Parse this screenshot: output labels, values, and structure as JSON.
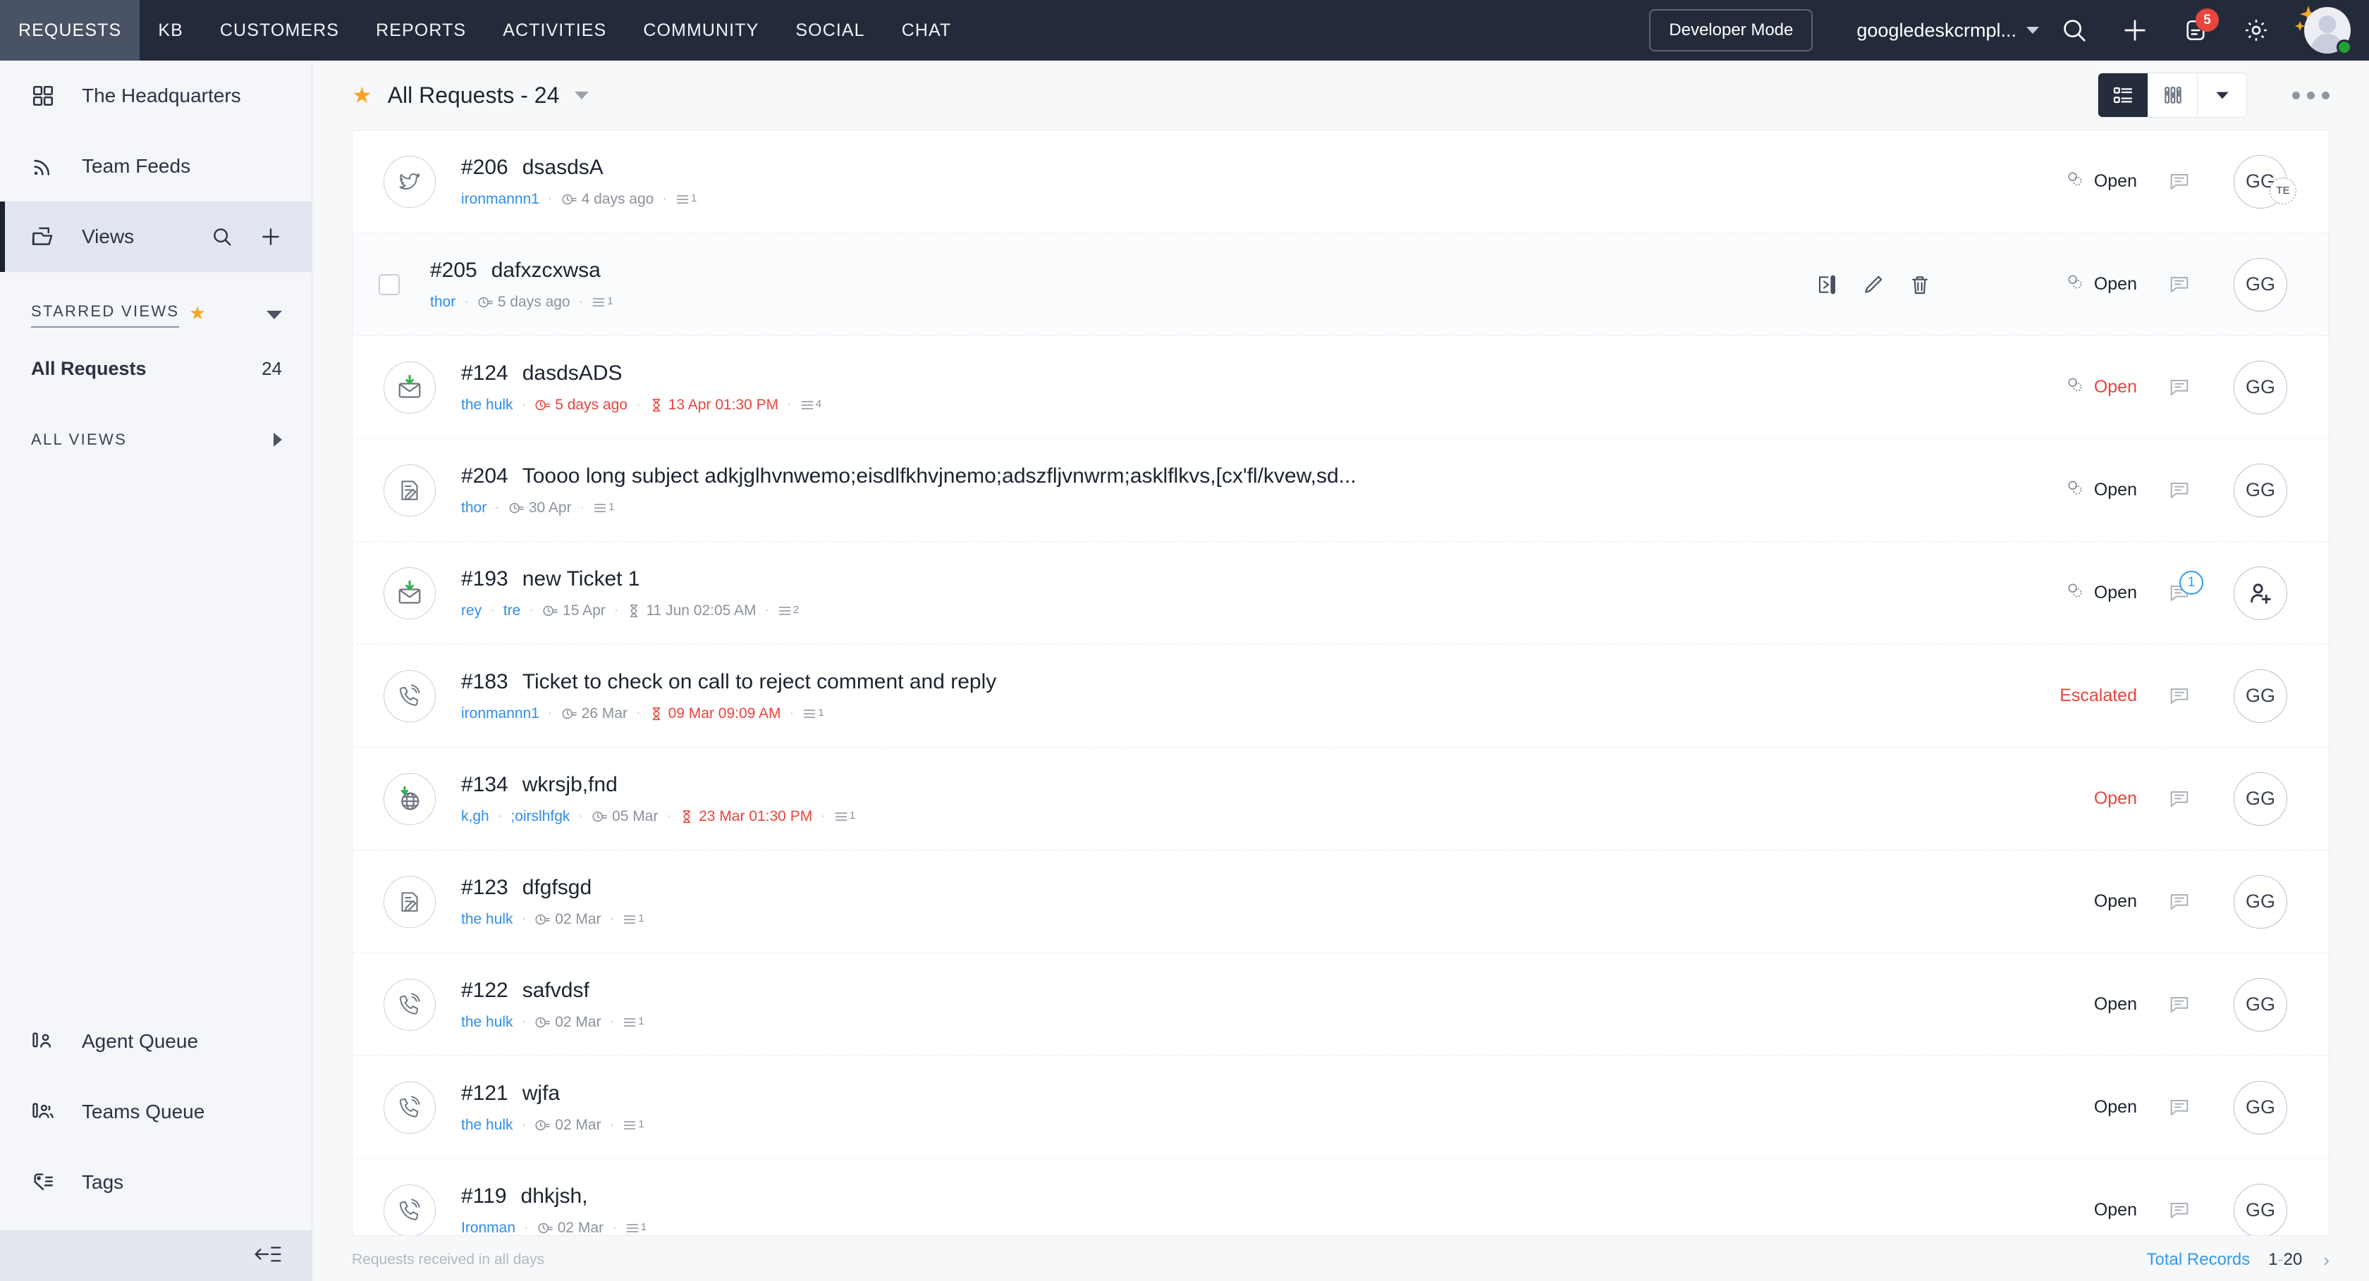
{
  "topbar": {
    "tabs": [
      {
        "label": "REQUESTS",
        "active": true
      },
      {
        "label": "KB",
        "active": false
      },
      {
        "label": "CUSTOMERS",
        "active": false
      },
      {
        "label": "REPORTS",
        "active": false
      },
      {
        "label": "ACTIVITIES",
        "active": false
      },
      {
        "label": "COMMUNITY",
        "active": false
      },
      {
        "label": "SOCIAL",
        "active": false
      },
      {
        "label": "CHAT",
        "active": false
      }
    ],
    "developer_mode_label": "Developer Mode",
    "org_name": "googledeskcrmpl...",
    "notification_count": "5",
    "icons": [
      "search-icon",
      "plus-icon",
      "notifications-icon",
      "gear-icon",
      "avatar"
    ],
    "accent_badge_color": "#e8453c",
    "bar_color": "#232b3b",
    "active_tab_color": "#4a5365"
  },
  "sidebar": {
    "items": [
      {
        "label": "The Headquarters",
        "icon": "grid-icon"
      },
      {
        "label": "Team Feeds",
        "icon": "feed-icon"
      },
      {
        "label": "Views",
        "icon": "folder-views-icon",
        "active": true
      }
    ],
    "views_actions": [
      "search-icon",
      "plus-icon"
    ],
    "starred_views_label": "STARRED VIEWS",
    "starred_views": [
      {
        "label": "All Requests",
        "count": "24"
      }
    ],
    "all_views_label": "ALL VIEWS",
    "bottom_items": [
      {
        "label": "Agent Queue",
        "icon": "agent-queue-icon"
      },
      {
        "label": "Teams Queue",
        "icon": "teams-queue-icon"
      },
      {
        "label": "Tags",
        "icon": "tag-icon"
      }
    ],
    "collapse_icon": "collapse-sidebar-icon"
  },
  "content": {
    "view_title": "All Requests - 24",
    "starred": true,
    "view_modes": [
      {
        "name": "list-view",
        "active": true
      },
      {
        "name": "compact-view",
        "active": false
      },
      {
        "name": "view-mode-dropdown",
        "active": false
      }
    ],
    "more_options_label": "more-options"
  },
  "tickets": [
    {
      "id": "#206",
      "subject": "dsasdsA",
      "channel_icon": "twitter-icon",
      "requesters": [
        "ironmannn1"
      ],
      "created": "4 days ago",
      "due": null,
      "thread_count": "1",
      "status": "Open",
      "status_color": "dark",
      "has_approval_icon": true,
      "comment_badge": null,
      "owner_initials": "GG",
      "owner_sub_badge": "TE",
      "owner_icon": null,
      "overdue": false,
      "created_overdue": false,
      "hovered": false
    },
    {
      "id": "#205",
      "subject": "dafxzcxwsa",
      "channel_icon": "checkbox",
      "requesters": [
        "thor"
      ],
      "created": "5 days ago",
      "due": null,
      "thread_count": "1",
      "status": "Open",
      "status_color": "dark",
      "has_approval_icon": true,
      "comment_badge": null,
      "owner_initials": "GG",
      "owner_sub_badge": null,
      "owner_icon": null,
      "overdue": false,
      "created_overdue": false,
      "hovered": true,
      "hover_actions": [
        "move-icon",
        "edit-icon",
        "delete-icon"
      ]
    },
    {
      "id": "#124",
      "subject": "dasdsADS",
      "channel_icon": "email-in-icon",
      "requesters": [
        "the hulk"
      ],
      "created": "5 days ago",
      "due": "13 Apr 01:30 PM",
      "thread_count": "4",
      "status": "Open",
      "status_color": "red",
      "has_approval_icon": true,
      "comment_badge": null,
      "owner_initials": "GG",
      "owner_sub_badge": null,
      "owner_icon": null,
      "overdue": true,
      "created_overdue": true,
      "hovered": false
    },
    {
      "id": "#204",
      "subject": "Toooo long subject adkjglhvnwemo;eisdlfkhvjnemo;adszfljvnwrm;asklflkvs,[cx'fl/kvew,sd...",
      "channel_icon": "form-icon",
      "requesters": [
        "thor"
      ],
      "created": "30 Apr",
      "due": null,
      "thread_count": "1",
      "status": "Open",
      "status_color": "dark",
      "has_approval_icon": true,
      "comment_badge": null,
      "owner_initials": "GG",
      "owner_sub_badge": null,
      "owner_icon": null,
      "overdue": false,
      "created_overdue": false,
      "hovered": false
    },
    {
      "id": "#193",
      "subject": "new Ticket 1",
      "channel_icon": "email-in-icon",
      "requesters": [
        "rey",
        "tre"
      ],
      "created": "15 Apr",
      "due": "11 Jun 02:05 AM",
      "thread_count": "2",
      "status": "Open",
      "status_color": "dark",
      "has_approval_icon": true,
      "comment_badge": "1",
      "owner_initials": null,
      "owner_sub_badge": null,
      "owner_icon": "add-user-icon",
      "overdue": false,
      "created_overdue": false,
      "hovered": false
    },
    {
      "id": "#183",
      "subject": "Ticket to check on call to reject comment and reply",
      "channel_icon": "phone-icon",
      "requesters": [
        "ironmannn1"
      ],
      "created": "26 Mar",
      "due": "09 Mar 09:09 AM",
      "thread_count": "1",
      "status": "Escalated",
      "status_color": "red",
      "has_approval_icon": false,
      "comment_badge": null,
      "owner_initials": "GG",
      "owner_sub_badge": null,
      "owner_icon": null,
      "overdue": true,
      "created_overdue": false,
      "hovered": false
    },
    {
      "id": "#134",
      "subject": "wkrsjb,fnd",
      "channel_icon": "web-icon",
      "requesters": [
        "k,gh",
        ";oirslhfgk"
      ],
      "created": "05 Mar",
      "due": "23 Mar 01:30 PM",
      "thread_count": "1",
      "status": "Open",
      "status_color": "red",
      "has_approval_icon": false,
      "comment_badge": null,
      "owner_initials": "GG",
      "owner_sub_badge": null,
      "owner_icon": null,
      "overdue": true,
      "created_overdue": false,
      "hovered": false
    },
    {
      "id": "#123",
      "subject": "dfgfsgd",
      "channel_icon": "form-icon",
      "requesters": [
        "the hulk"
      ],
      "created": "02 Mar",
      "due": null,
      "thread_count": "1",
      "status": "Open",
      "status_color": "dark",
      "has_approval_icon": false,
      "comment_badge": null,
      "owner_initials": "GG",
      "owner_sub_badge": null,
      "owner_icon": null,
      "overdue": false,
      "created_overdue": false,
      "hovered": false
    },
    {
      "id": "#122",
      "subject": "safvdsf",
      "channel_icon": "phone-icon",
      "requesters": [
        "the hulk"
      ],
      "created": "02 Mar",
      "due": null,
      "thread_count": "1",
      "status": "Open",
      "status_color": "dark",
      "has_approval_icon": false,
      "comment_badge": null,
      "owner_initials": "GG",
      "owner_sub_badge": null,
      "owner_icon": null,
      "overdue": false,
      "created_overdue": false,
      "hovered": false
    },
    {
      "id": "#121",
      "subject": "wjfa",
      "channel_icon": "phone-icon",
      "requesters": [
        "the hulk"
      ],
      "created": "02 Mar",
      "due": null,
      "thread_count": "1",
      "status": "Open",
      "status_color": "dark",
      "has_approval_icon": false,
      "comment_badge": null,
      "owner_initials": "GG",
      "owner_sub_badge": null,
      "owner_icon": null,
      "overdue": false,
      "created_overdue": false,
      "hovered": false
    },
    {
      "id": "#119",
      "subject": "dhkjsh,",
      "channel_icon": "phone-icon",
      "requesters": [
        "Ironman"
      ],
      "created": "02 Mar",
      "due": null,
      "thread_count": "1",
      "status": "Open",
      "status_color": "dark",
      "has_approval_icon": false,
      "comment_badge": null,
      "owner_initials": "GG",
      "owner_sub_badge": null,
      "owner_icon": null,
      "overdue": false,
      "created_overdue": false,
      "hovered": false
    }
  ],
  "footer": {
    "note": "Requests received in all days",
    "total_records_label": "Total Records",
    "page_start": "1",
    "page_dash": "-",
    "page_end": "20",
    "next_icon": "chevron-right-icon"
  },
  "colors": {
    "link_blue": "#2f8ded",
    "danger_red": "#e8453c",
    "star_orange": "#f5a623",
    "dark_nav": "#232b3b"
  }
}
